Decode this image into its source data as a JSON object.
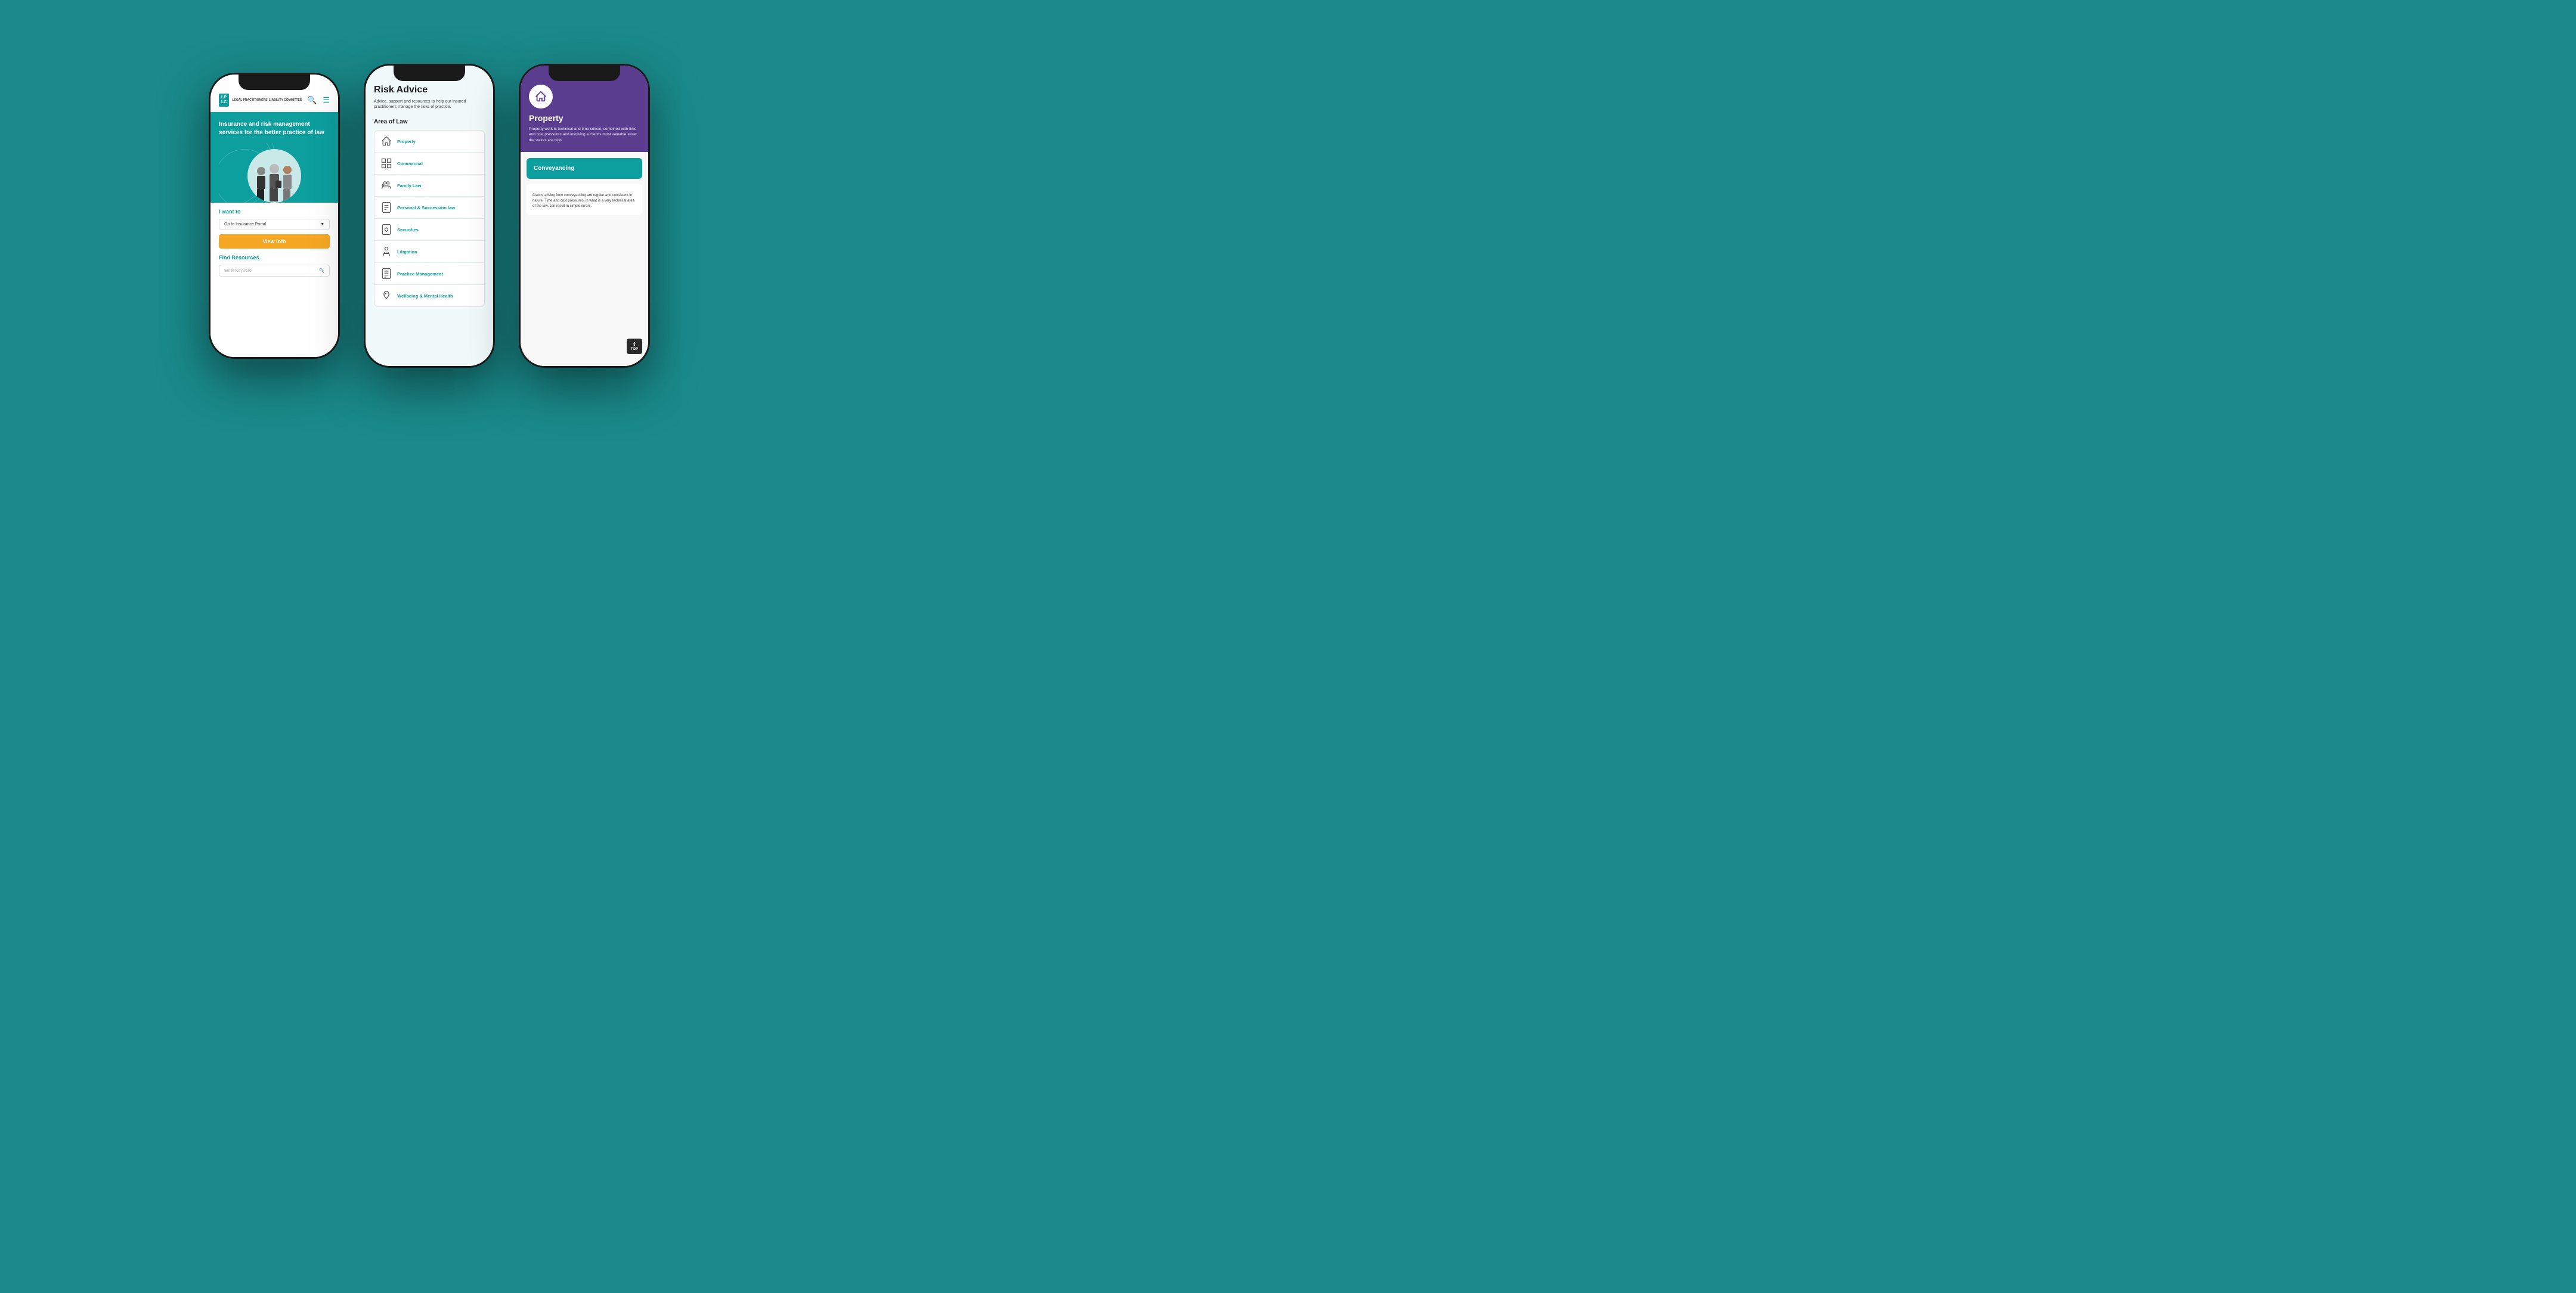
{
  "background_color": "#1a8a8a",
  "phone1": {
    "logo_line1": "LP",
    "logo_line2": "LC",
    "logo_text": "LEGAL\nPRACTITIONERS'\nLIABILITY\nCOMMITTEE",
    "hero_title": "Insurance and risk management services for the better practice of law",
    "want_label": "I want to",
    "select_value": "Go to Insurance Portal",
    "view_info_label": "View info",
    "find_resources_label": "Find Resources",
    "search_placeholder": "Enter Keyword"
  },
  "phone2": {
    "title": "Risk Advice",
    "subtitle": "Advice, support and resources to help our insured practitioners manage the risks of practice.",
    "area_title": "Area of Law",
    "items": [
      {
        "label": "Property",
        "icon": "house"
      },
      {
        "label": "Commercial",
        "icon": "building"
      },
      {
        "label": "Family Law",
        "icon": "family"
      },
      {
        "label": "Personal & Succession law",
        "icon": "document"
      },
      {
        "label": "Securities",
        "icon": "dollar-doc"
      },
      {
        "label": "Litigation",
        "icon": "person"
      },
      {
        "label": "Practice Management",
        "icon": "grid-doc"
      },
      {
        "label": "Wellbeing & Mental Health",
        "icon": "brain"
      }
    ]
  },
  "phone3": {
    "section": "Property",
    "section_desc": "Property work is technical and time critical, combined with time and cost pressures and involving a client's most valuable asset, the stakes are high.",
    "card_title": "Conveyancing",
    "card_body": "Claims arising from conveyancing are regular and consistent in nature. Time and cost pressures, in what is a very technical area of the law, can result in simple errors.",
    "top_label": "TOP"
  }
}
